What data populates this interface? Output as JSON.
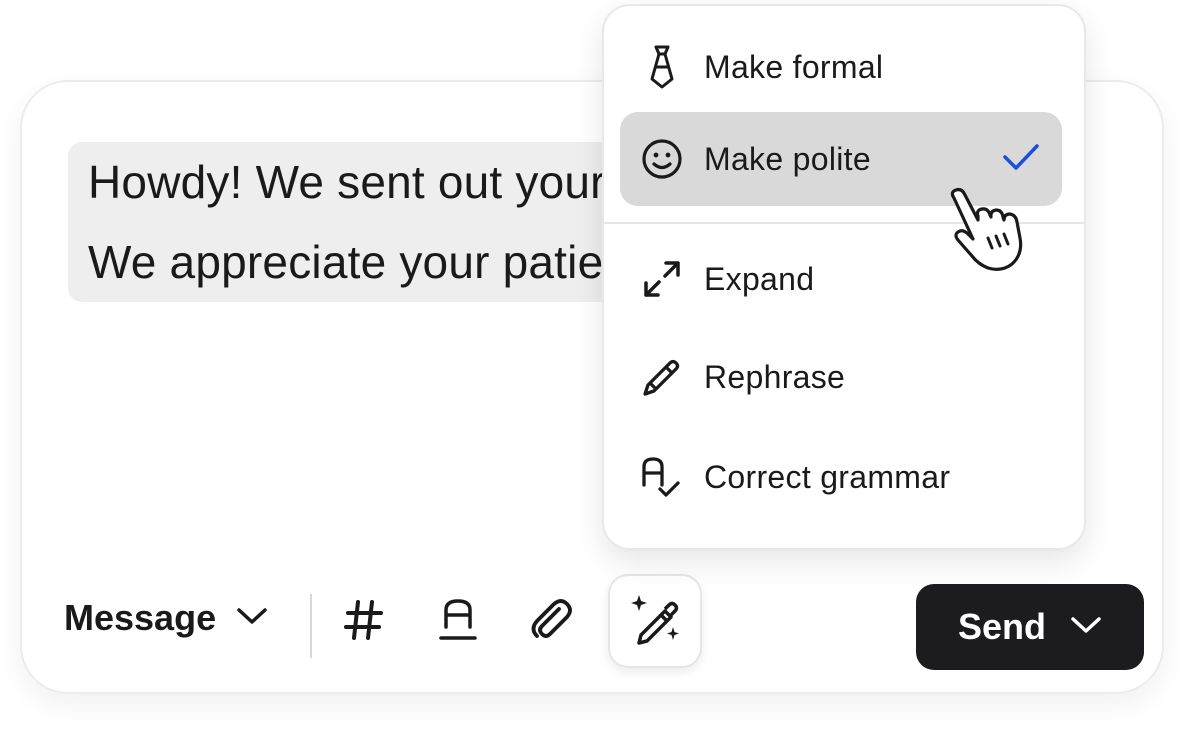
{
  "composer": {
    "message_lines": [
      "Howdy! We sent out your order today.",
      "We appreciate your patience."
    ],
    "message_type": "Message",
    "send_label": "Send"
  },
  "toolbar_icons": [
    "hash-icon",
    "text-format-icon",
    "paperclip-icon",
    "magic-wand-icon"
  ],
  "ai_menu": {
    "items": [
      {
        "label": "Make formal",
        "icon": "tie-icon",
        "selected": false
      },
      {
        "label": "Make polite",
        "icon": "smiley-icon",
        "selected": true
      },
      {
        "label": "Expand",
        "icon": "expand-arrows-icon",
        "selected": false
      },
      {
        "label": "Rephrase",
        "icon": "pencil-icon",
        "selected": false
      },
      {
        "label": "Correct grammar",
        "icon": "spellcheck-icon",
        "selected": false
      }
    ]
  },
  "colors": {
    "accent_check": "#1d4ed8",
    "send_bg": "#1c1c1e",
    "selected_bg": "#d9d9d9",
    "text_highlight_bg": "#eeeeee"
  }
}
